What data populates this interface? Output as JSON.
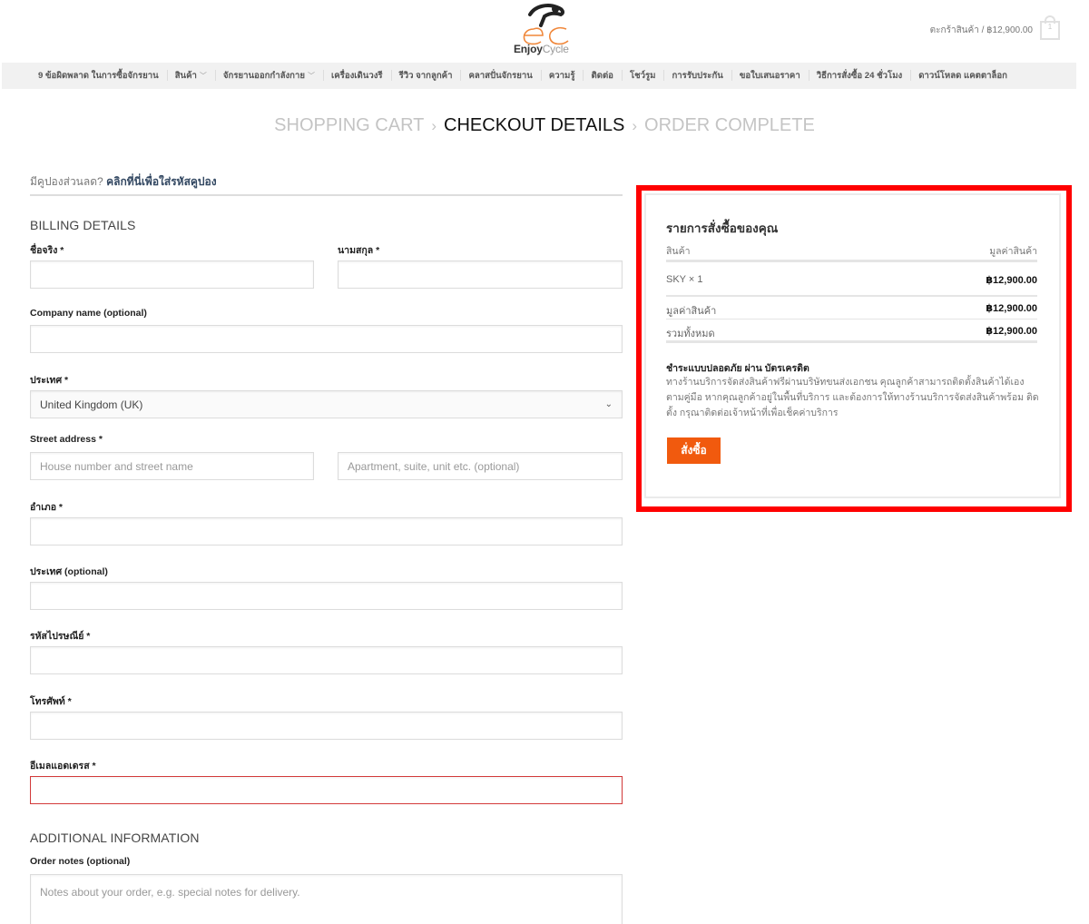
{
  "header": {
    "logo_primary": "Enjoy",
    "logo_secondary": "Cycle",
    "cart_label": "ตะกร้าสินค้า / ฿12,900.00",
    "cart_count": "1"
  },
  "nav": {
    "items": [
      {
        "label": "9 ข้อผิดพลาด ในการซื้อจักรยาน",
        "dropdown": false
      },
      {
        "label": "สินค้า",
        "dropdown": true
      },
      {
        "label": "จักรยานออกกำลังกาย",
        "dropdown": true
      },
      {
        "label": "เครื่องเดินวงรี",
        "dropdown": false
      },
      {
        "label": "รีวิว จากลูกค้า",
        "dropdown": false
      },
      {
        "label": "คลาสปั่นจักรยาน",
        "dropdown": false
      },
      {
        "label": "ความรู้",
        "dropdown": false
      },
      {
        "label": "ติดต่อ",
        "dropdown": false
      },
      {
        "label": "โชว์รูม",
        "dropdown": false
      },
      {
        "label": "การรับประกัน",
        "dropdown": false
      },
      {
        "label": "ขอใบเสนอราคา",
        "dropdown": false
      },
      {
        "label": "วิธีการสั่งซื้อ 24 ชั่วโมง",
        "dropdown": false
      },
      {
        "label": "ดาวน์โหลด แคตตาล็อก",
        "dropdown": false
      }
    ],
    "dropdown_glyph": "﹀"
  },
  "steps": {
    "items": [
      "SHOPPING CART",
      "CHECKOUT DETAILS",
      "ORDER COMPLETE"
    ],
    "active_index": 1,
    "separator": "›"
  },
  "coupon": {
    "prompt": "มีคูปองส่วนลด?",
    "link": "คลิกที่นี่เพื่อใส่รหัสคูปอง"
  },
  "billing": {
    "title": "BILLING DETAILS",
    "first_name_label": "ชื่อจริง *",
    "last_name_label": "นามสกุล *",
    "company_label": "Company name (optional)",
    "country_label": "ประเทศ *",
    "country_value": "United Kingdom (UK)",
    "street_label": "Street address *",
    "street1_placeholder": "House number and street name",
    "street2_placeholder": "Apartment, suite, unit etc. (optional)",
    "district_label": "อำเภอ *",
    "state_label": "ประเทศ (optional)",
    "postcode_label": "รหัสไปรษณีย์ *",
    "phone_label": "โทรศัพท์ *",
    "email_label": "อีเมลแอดเดรส *"
  },
  "additional": {
    "title": "ADDITIONAL INFORMATION",
    "notes_label": "Order notes (optional)",
    "notes_placeholder": "Notes about your order, e.g. special notes for delivery."
  },
  "order": {
    "title": "รายการสั่งซื้อของคุณ",
    "col_product": "สินค้า",
    "col_total": "มูลค่าสินค้า",
    "items": [
      {
        "name": "SKY × 1",
        "price": "฿12,900.00"
      }
    ],
    "subtotal_label": "มูลค่าสินค้า",
    "subtotal_value": "฿12,900.00",
    "total_label": "รวมทั้งหมด",
    "total_value": "฿12,900.00",
    "payment_title": "ชำระแบบปลอดภัย ผ่าน บัตรเครดิต",
    "payment_desc": "ทางร้านบริการจัดส่งสินค้าฟรีผ่านบริษัทขนส่งเอกชน คุณลูกค้าสามารถติดตั้งสินค้าได้เอง ตามคู่มือ หากคุณลูกค้าอยู่ในพื้นที่บริการ และต้องการให้ทางร้านบริการจัดส่งสินค้าพร้อม ติดตั้ง กรุณาติดต่อเจ้าหน้าที่เพื่อเช็คค่าบริการ",
    "place_order_label": "สั่งซื้อ"
  },
  "colors": {
    "accent_orange": "#f15a0e",
    "highlight_red": "#ff0000",
    "error_border": "#d33a3a",
    "link_blue": "#334862"
  }
}
